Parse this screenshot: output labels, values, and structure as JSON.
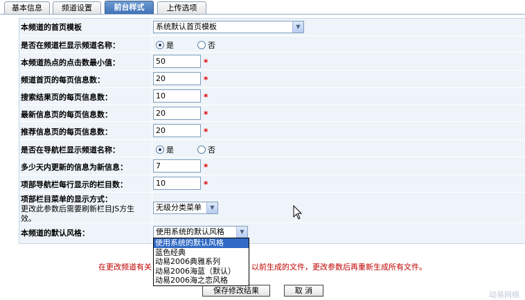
{
  "tabs": [
    {
      "label": "基本信息",
      "active": false
    },
    {
      "label": "频道设置",
      "active": false
    },
    {
      "label": "前台样式",
      "active": true
    },
    {
      "label": "上传选项",
      "active": false
    }
  ],
  "form": {
    "home_template_label": "本频道的首页模板",
    "home_template_value": "系统默认首页模板",
    "show_channel_name_label": "是否在频道栏显示频道名称：",
    "show_channel_yes": "是",
    "show_channel_no": "否",
    "hot_min_label": "本频道热点的点击数最小值：",
    "hot_min_value": "50",
    "home_per_page_label": "频道首页的每页信息数：",
    "home_per_page_value": "20",
    "search_per_page_label": "搜索结果页的每页信息数：",
    "search_per_page_value": "10",
    "latest_per_page_label": "最新信息页的每页信息数：",
    "latest_per_page_value": "20",
    "recommend_per_page_label": "推荐信息页的每页信息数：",
    "recommend_per_page_value": "20",
    "show_nav_name_label": "是否在导航栏显示频道名称：",
    "show_nav_yes": "是",
    "show_nav_no": "否",
    "new_days_label": "多少天内更新的信息为新信息：",
    "new_days_value": "7",
    "top_nav_cols_label": "项部导航栏每行显示的栏目数：",
    "top_nav_cols_value": "10",
    "top_menu_label": "项部栏目菜单的显示方式：",
    "top_menu_note_1": "更改此参数后需要刷新栏目JS方生",
    "top_menu_note_2": "效。",
    "top_menu_value": "无级分类菜单",
    "default_style_label": "本频道的默认风格：",
    "default_style_value": "使用系统的默认风格",
    "required_mark": "*"
  },
  "style_options": [
    "使用系统的默认风格",
    "蓝色经典",
    "动易2006典雅系列",
    "动易2006海蓝（默认）",
    "动易2006海之恋风格"
  ],
  "notice": {
    "left": "在更改频道有关",
    "right": "以前生成的文件，更改参数后再重新生成所有文件。"
  },
  "buttons": {
    "save": "保存修改结果",
    "cancel": "取 消"
  },
  "brand": "动易网络"
}
